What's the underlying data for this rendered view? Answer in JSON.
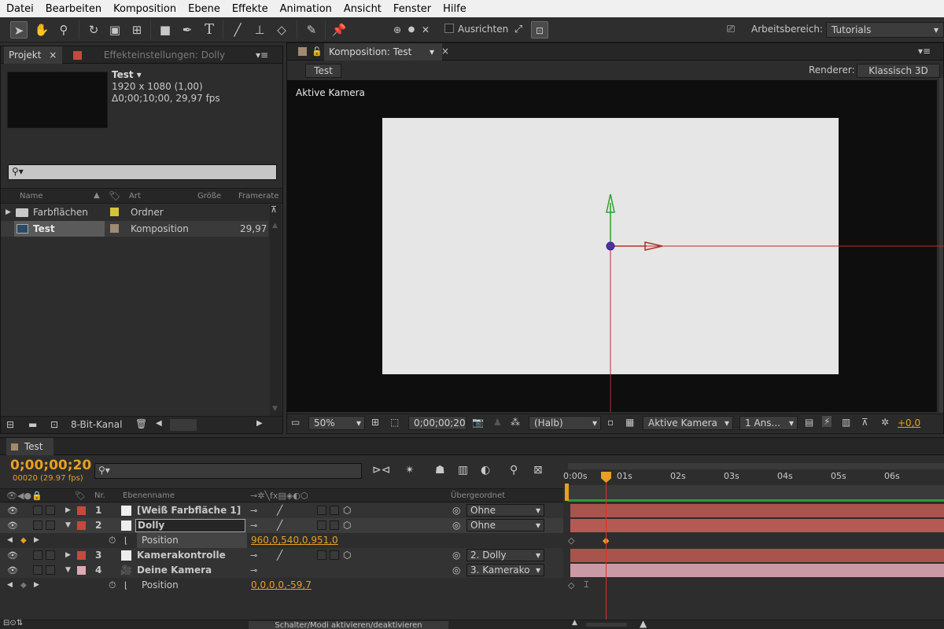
{
  "menu": [
    "Datei",
    "Bearbeiten",
    "Komposition",
    "Ebene",
    "Effekte",
    "Animation",
    "Ansicht",
    "Fenster",
    "Hilfe"
  ],
  "toolbar": {
    "align_label": "Ausrichten",
    "workspace_label": "Arbeitsbereich:",
    "workspace_value": "Tutorials"
  },
  "project": {
    "tab_label": "Projekt",
    "effects_tab_label": "Effekteinstellungen: Dolly",
    "comp_name": "Test ▾",
    "comp_size": "1920 x 1080 (1,00)",
    "comp_duration": "Δ0;00;10;00, 29,97 fps",
    "search_placeholder": "",
    "columns": [
      "Name",
      "Art",
      "Größe",
      "Framerate"
    ],
    "items": [
      {
        "name": "Farbflächen",
        "type": "Ordner",
        "size": "",
        "framerate": "",
        "color": "#d7c43a"
      },
      {
        "name": "Test",
        "type": "Komposition",
        "size": "",
        "framerate": "29,97",
        "color": "#a08a70"
      }
    ],
    "bit_depth": "8-Bit-Kanal"
  },
  "composition": {
    "tab_label": "Komposition: Test",
    "breadcrumb": "Test",
    "renderer_label": "Renderer:",
    "renderer_value": "Klassisch 3D",
    "camera_label": "Aktive Kamera",
    "zoom": "50%",
    "timecode": "0;00;00;20",
    "resolution": "(Halb)",
    "view_camera": "Aktive Kamera",
    "view_count": "1 Ans...",
    "exposure": "+0,0"
  },
  "timeline": {
    "tab_label": "Test",
    "timecode": "0;00;00;20",
    "frame_info": "00020 (29.97 fps)",
    "col_nr": "Nr.",
    "col_name": "Ebenenname",
    "col_parent": "Übergeordnet",
    "ruler": [
      "0:00s",
      "01s",
      "02s",
      "03s",
      "04s",
      "05s",
      "06s"
    ],
    "layers": [
      {
        "nr": "1",
        "name": "[Weiß Farbfläche 1]",
        "parent": "Ohne",
        "label_color": "#c8483e",
        "bar_color": "#a9534d"
      },
      {
        "nr": "2",
        "name": "Dolly",
        "parent": "Ohne",
        "label_color": "#c8483e",
        "bar_color": "#a9534d"
      },
      {
        "nr": "3",
        "name": "Kamerakontrolle",
        "parent": "2. Dolly",
        "label_color": "#c8483e",
        "bar_color": "#a9534d"
      },
      {
        "nr": "4",
        "name": "Deine Kamera",
        "parent": "3. Kamerako",
        "label_color": "#e0a8b4",
        "bar_color": "#c99aa5"
      }
    ],
    "prop_dolly_name": "Position",
    "prop_dolly_value": "960,0,540,0,951,0",
    "prop_cam_name": "Position",
    "prop_cam_value": "0,0,0,0,-59,7",
    "footer_toggle": "Schalter/Modi aktivieren/deaktivieren"
  },
  "colors": {
    "accent": "#e8a020",
    "playhead": "#e03020",
    "work_area": "#2a9a3a"
  }
}
